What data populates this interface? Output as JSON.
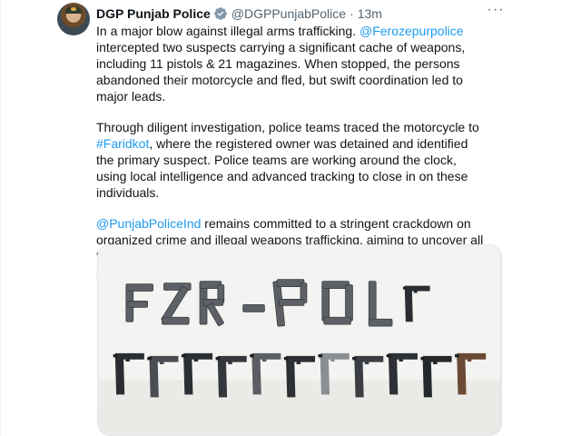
{
  "tweet": {
    "author_name": "DGP Punjab Police",
    "handle": "@DGPPunjabPolice",
    "separator": "·",
    "time": "13m",
    "more_icon": "···",
    "paragraphs": [
      {
        "segments": [
          {
            "text": "In a major blow against illegal arms trafficking. ",
            "link": false
          },
          {
            "text": "@Ferozepurpolice",
            "link": true
          },
          {
            "text": " intercepted two suspects carrying a significant cache of weapons, including 11 pistols & 21 magazines. When stopped, the persons abandoned their motorcycle and fled, but swift coordination led to major leads.",
            "link": false
          }
        ]
      },
      {
        "segments": [
          {
            "text": "Through diligent investigation, police teams traced the motorcycle to ",
            "link": false
          },
          {
            "text": "#Faridkot",
            "link": true
          },
          {
            "text": ", where the registered owner was detained and identified the primary suspect. Police teams are working around the clock, using local intelligence and advanced tracking to close in on these individuals.",
            "link": false
          }
        ]
      },
      {
        "segments": [
          {
            "text": "@PunjabPoliceInd",
            "link": true
          },
          {
            "text": " remains committed to a stringent crackdown on organized crime and illegal weapons trafficking, aiming to uncover all forward and backward linkages within these networks to ensure public safety.",
            "link": false
          }
        ]
      }
    ],
    "media": {
      "pistol_count": 11,
      "magazine_count": 21
    }
  },
  "colors": {
    "link": "#1d9bf0",
    "text": "#0f1419",
    "muted": "#536471",
    "verified_badge": "#829aab"
  },
  "icons": {
    "verified": "verified-badge-icon",
    "more": "more-options-icon"
  }
}
